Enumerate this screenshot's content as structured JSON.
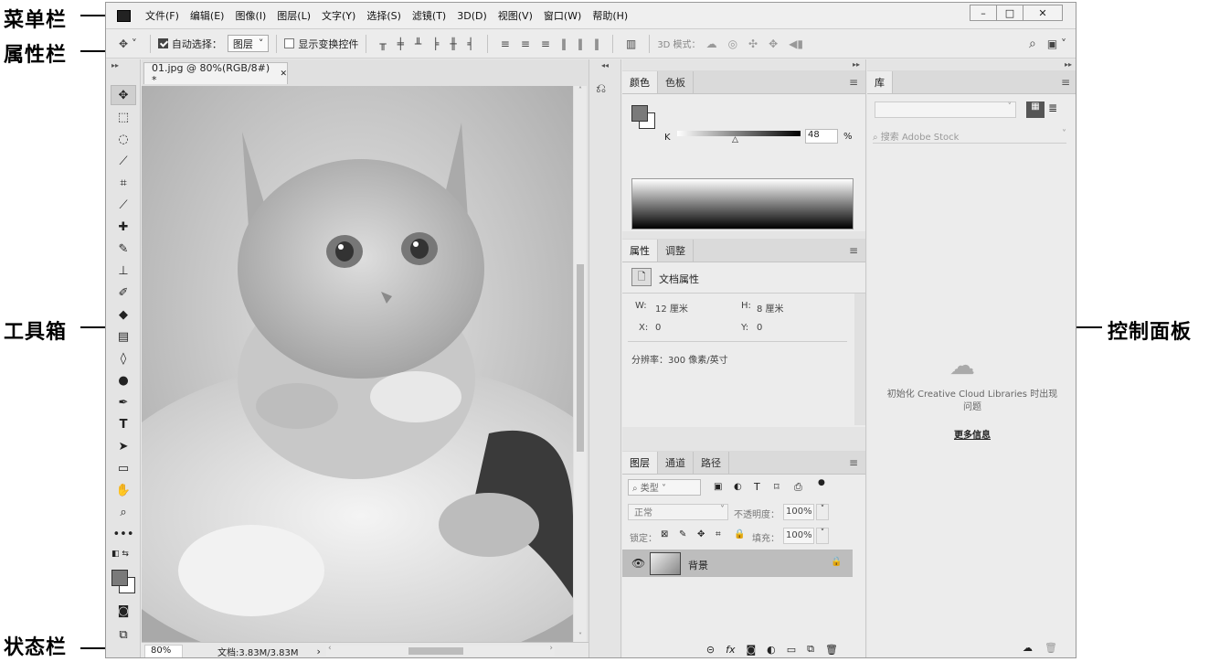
{
  "annotations": {
    "menubar": "菜单栏",
    "optionsbar": "属性栏",
    "toolbox": "工具箱",
    "statusbar": "状态栏",
    "panels": "控制面板"
  },
  "menu": [
    "文件(F)",
    "编辑(E)",
    "图像(I)",
    "图层(L)",
    "文字(Y)",
    "选择(S)",
    "滤镜(T)",
    "3D(D)",
    "视图(V)",
    "窗口(W)",
    "帮助(H)"
  ],
  "window_buttons": {
    "minimize": "–",
    "maximize": "□",
    "close": "✕"
  },
  "options": {
    "auto_select_label": "自动选择：",
    "auto_select_value": "图层",
    "show_transform_label": "显示变换控件",
    "mode_3d_label": "3D 模式："
  },
  "document": {
    "tab_title": "01.jpg @ 80%(RGB/8#) *",
    "tab_close": "✕",
    "zoom": "80%",
    "doc_size": "文档:3.83M/3.83M"
  },
  "color_panel": {
    "tabs": [
      "颜色",
      "色板"
    ],
    "channel": "K",
    "value": "48",
    "unit": "%"
  },
  "properties_panel": {
    "tabs": [
      "属性",
      "调整"
    ],
    "title": "文档属性",
    "w_label": "W:",
    "w_value": "12 厘米",
    "h_label": "H:",
    "h_value": "8 厘米",
    "x_label": "X:",
    "x_value": "0",
    "y_label": "Y:",
    "y_value": "0",
    "resolution": "分辨率：300 像素/英寸"
  },
  "layers_panel": {
    "tabs": [
      "图层",
      "通道",
      "路径"
    ],
    "filter_kind": "类型",
    "blend_mode": "正常",
    "opacity_label": "不透明度：",
    "opacity_value": "100%",
    "lock_label": "锁定：",
    "fill_label": "填充：",
    "fill_value": "100%",
    "layer_name": "背景"
  },
  "library_panel": {
    "tab": "库",
    "search_placeholder": "搜索 Adobe Stock",
    "error_message": "初始化 Creative Cloud Libraries 时出现问题",
    "more_info": "更多信息"
  },
  "colors": {
    "foreground": "#7a7a7a",
    "background": "#ffffff",
    "layer_highlight": "#bdbdbd"
  }
}
